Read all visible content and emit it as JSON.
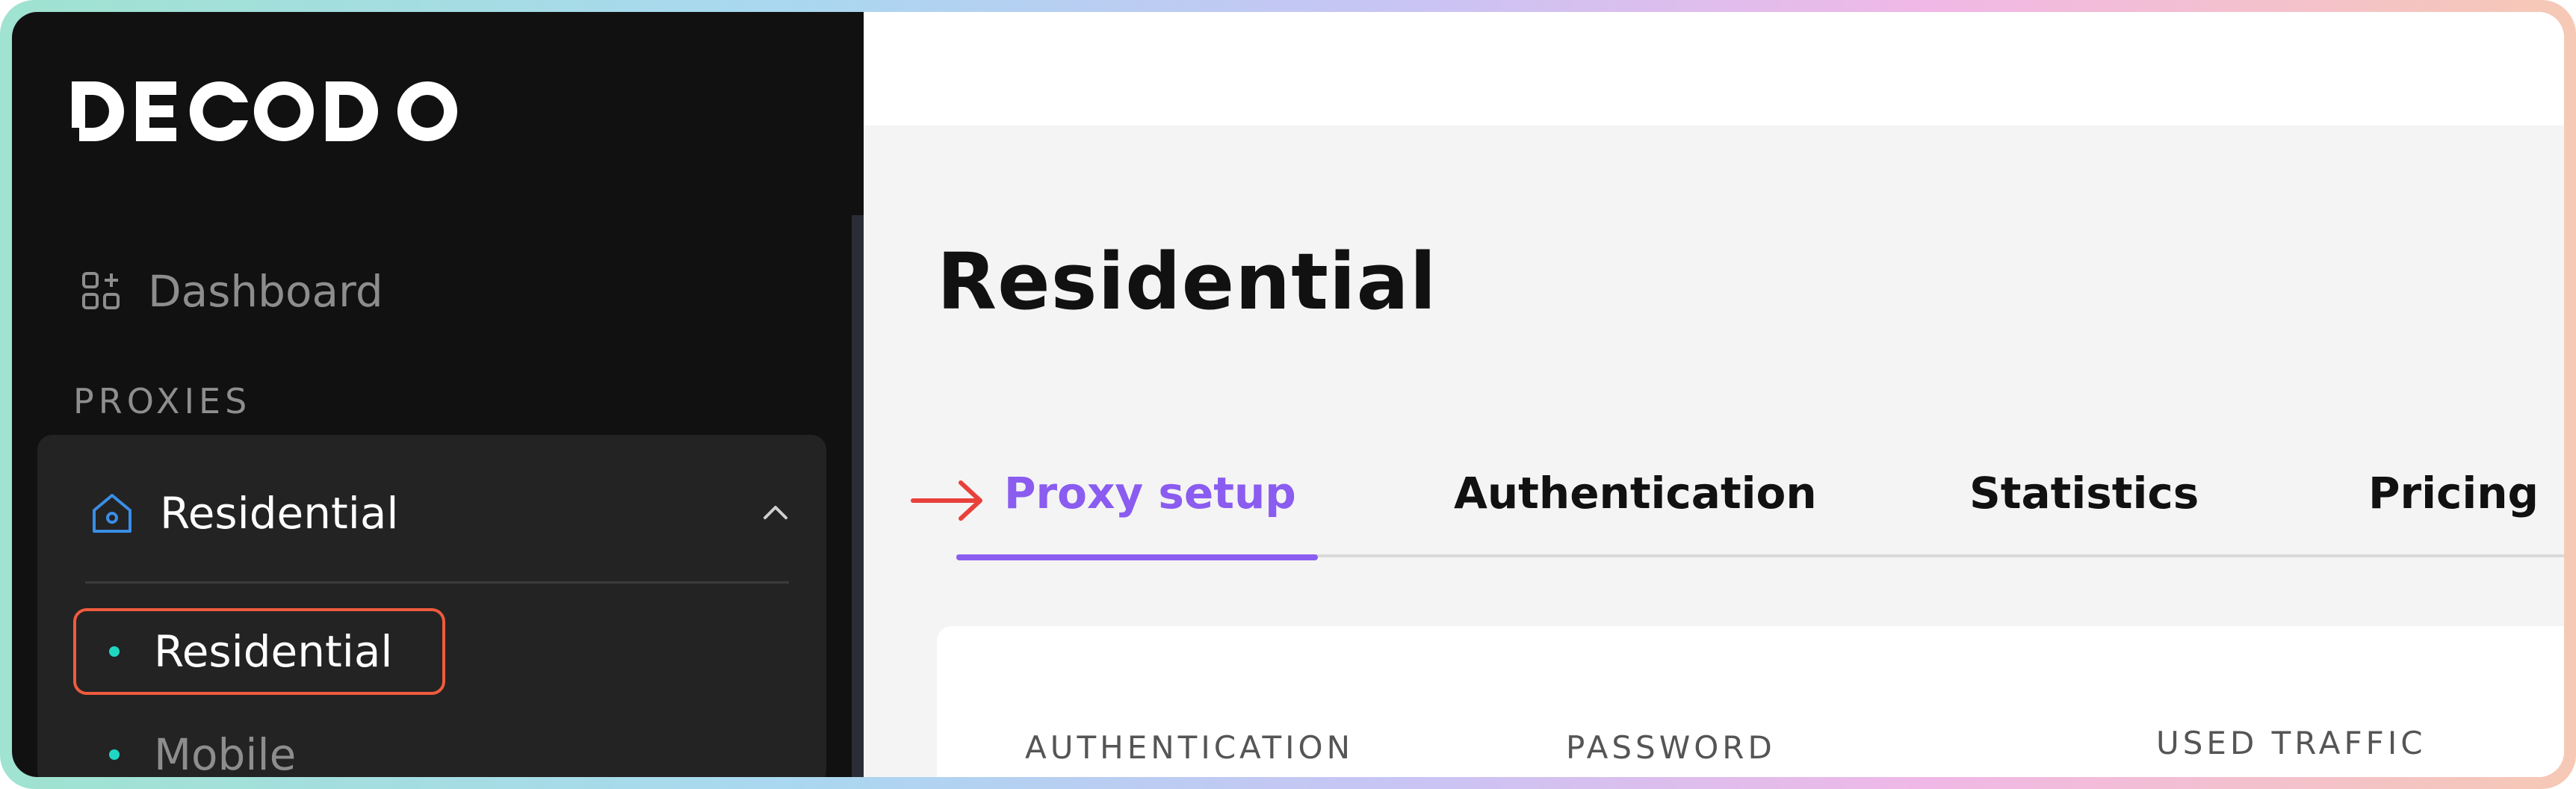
{
  "brand": {
    "name": "DECODO"
  },
  "sidebar": {
    "dashboard_label": "Dashboard",
    "section_label": "PROXIES",
    "group": {
      "label": "Residential",
      "expanded": true,
      "items": [
        {
          "label": "Residential",
          "active": true
        },
        {
          "label": "Mobile",
          "active": false
        }
      ]
    },
    "icons": {
      "dashboard": "dashboard-grid-icon",
      "group": "house-icon",
      "chevron": "chevron-up-icon",
      "bullet": "dot-icon"
    }
  },
  "main": {
    "title": "Residential",
    "tabs": [
      {
        "label": "Proxy setup",
        "active": true
      },
      {
        "label": "Authentication",
        "active": false
      },
      {
        "label": "Statistics",
        "active": false
      },
      {
        "label": "Pricing",
        "active": false
      }
    ],
    "table_headers": [
      "AUTHENTICATION",
      "PASSWORD",
      "USED TRAFFIC"
    ]
  },
  "colors": {
    "accent": "#8a5cf0",
    "highlight": "#ef5b3d",
    "bullet": "#20d6c2",
    "sidebar_bg": "#111111",
    "group_bg": "#232323"
  }
}
